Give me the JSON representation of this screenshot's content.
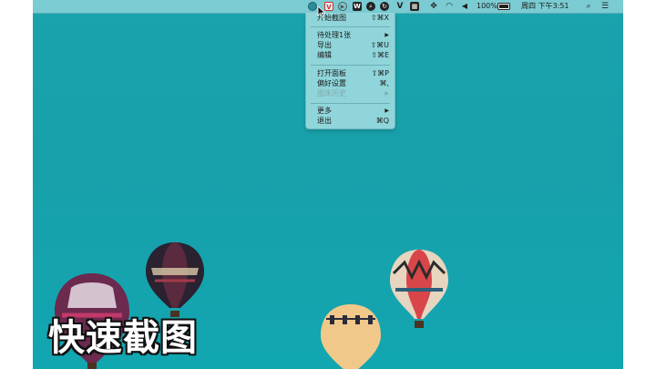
{
  "menubar": {
    "battery": "100%",
    "datetime": "周四 下午3:51",
    "icons": [
      "screenshot-app-icon",
      "vivaldi-icon",
      "play-icon",
      "vpn-icon",
      "search-app-icon",
      "sync-icon",
      "v-icon",
      "notes-icon",
      "network-icon",
      "wifi-icon",
      "volume-icon",
      "battery-icon",
      "spotlight-icon",
      "control-center-icon"
    ]
  },
  "menu": {
    "items": [
      {
        "label": "开始截图",
        "shortcut": "⇧⌘X"
      },
      {
        "label": "待处理1张",
        "shortcut": "▶"
      },
      {
        "label": "导出",
        "shortcut": "⇧⌘U"
      },
      {
        "label": "编辑",
        "shortcut": "⇧⌘E"
      },
      {
        "label": "打开面板",
        "shortcut": "⇧⌘P"
      },
      {
        "label": "偏好设置",
        "shortcut": "⌘,"
      },
      {
        "label": "图床历史",
        "shortcut": "▶"
      },
      {
        "label": "更多",
        "shortcut": "▶"
      },
      {
        "label": "退出",
        "shortcut": "⌘Q"
      }
    ]
  },
  "caption": "快速截图",
  "colors": {
    "sky": "#18a0aa",
    "menubar": "#96d7dc",
    "menu": "#aae1e4"
  }
}
